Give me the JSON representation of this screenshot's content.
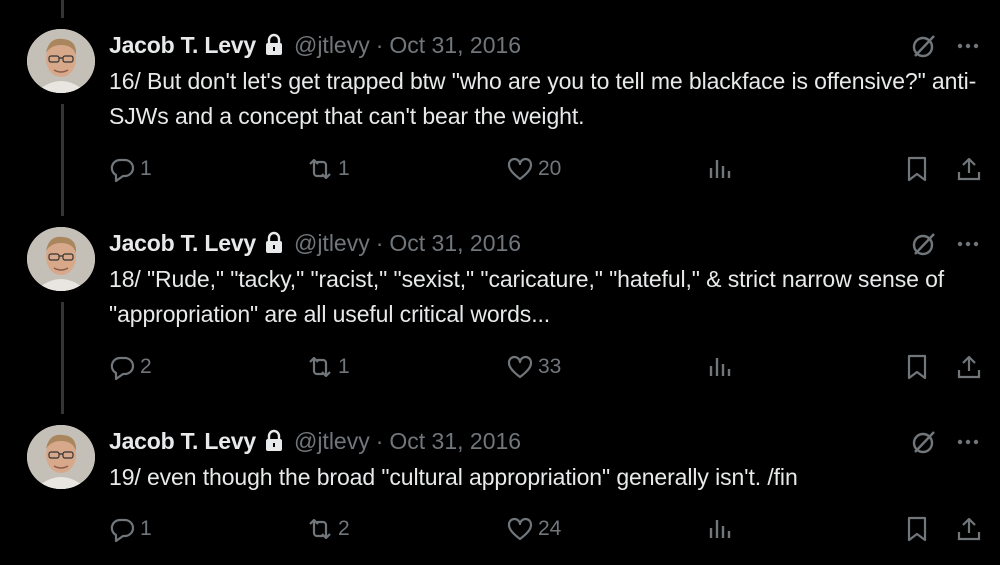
{
  "tweets": [
    {
      "name": "Jacob T. Levy",
      "handle": "@jtlevy",
      "separator": "·",
      "date": "Oct 31, 2016",
      "text": "16/ But don't let's get trapped btw \"who are you to tell me blackface is offensive?\" anti-SJWs and a concept that can't bear the weight.",
      "replies": "1",
      "retweets": "1",
      "likes": "20"
    },
    {
      "name": "Jacob T. Levy",
      "handle": "@jtlevy",
      "separator": "·",
      "date": "Oct 31, 2016",
      "text": "18/ \"Rude,\" \"tacky,\" \"racist,\" \"sexist,\" \"caricature,\" \"hateful,\" & strict narrow sense of \"appropriation\" are all useful critical words...",
      "replies": "2",
      "retweets": "1",
      "likes": "33"
    },
    {
      "name": "Jacob T. Levy",
      "handle": "@jtlevy",
      "separator": "·",
      "date": "Oct 31, 2016",
      "text": "19/ even though the broad \"cultural appropriation\" generally isn't. /fin",
      "replies": "1",
      "retweets": "2",
      "likes": "24"
    }
  ],
  "icons": {
    "protected": "lock-icon",
    "grok": "grok-icon",
    "more": "more-icon",
    "reply": "reply-icon",
    "retweet": "retweet-icon",
    "like": "heart-icon",
    "views": "views-icon",
    "bookmark": "bookmark-icon",
    "share": "share-icon"
  },
  "colors": {
    "background": "#000000",
    "primary_text": "#e7e9ea",
    "secondary_text": "#71767b",
    "thread_line": "#333639"
  }
}
